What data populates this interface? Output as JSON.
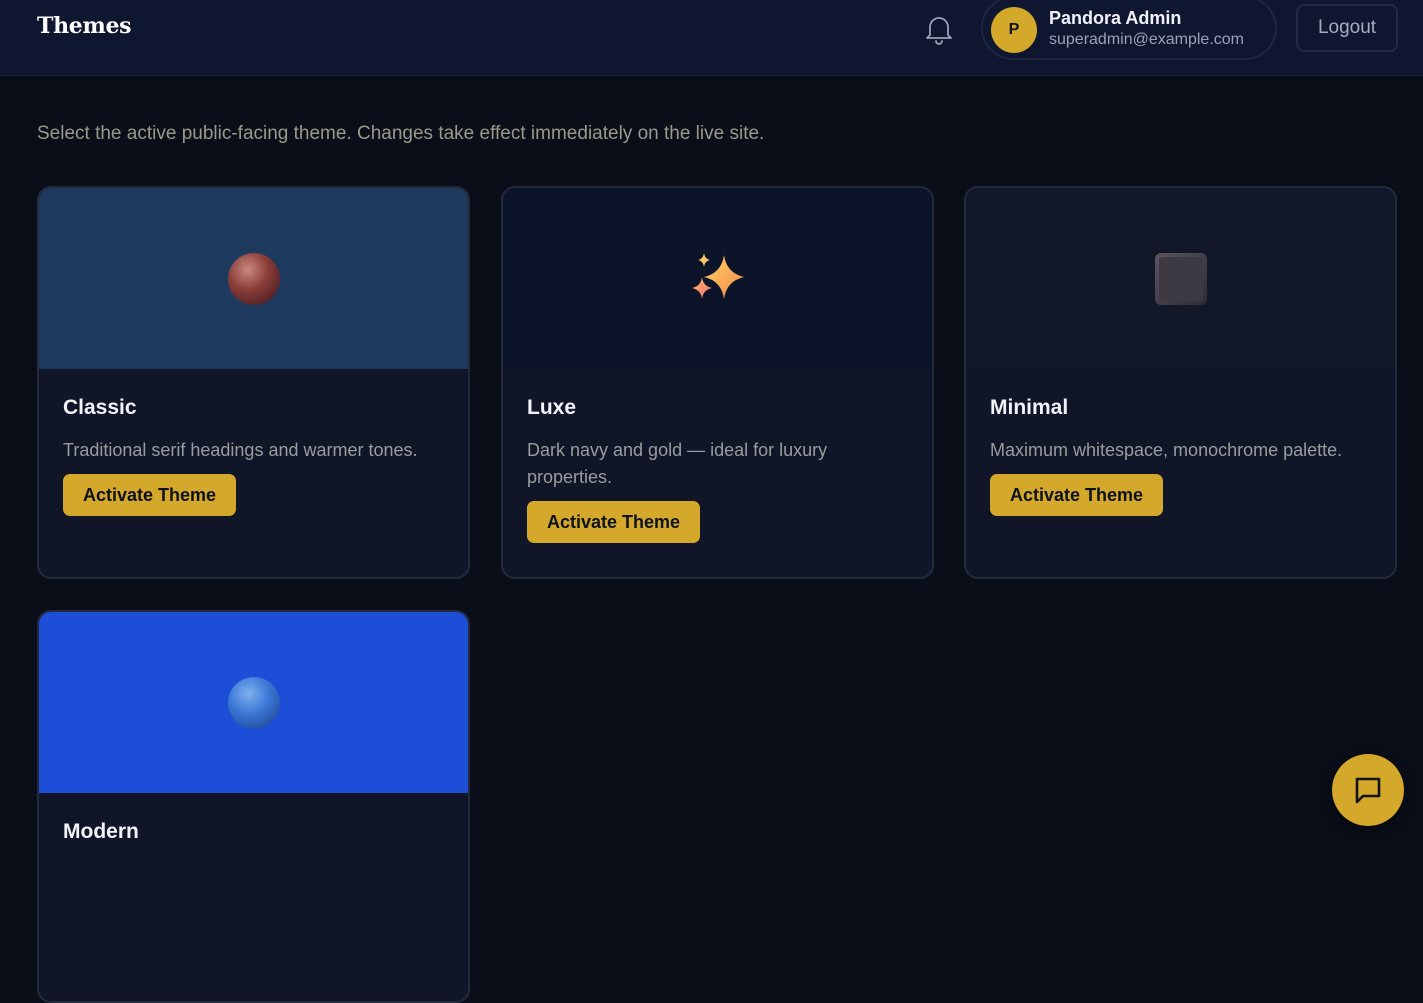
{
  "header": {
    "title": "Themes",
    "user": {
      "initial": "P",
      "name": "Pandora Admin",
      "email": "superadmin@example.com"
    },
    "logout_label": "Logout"
  },
  "main": {
    "intro": "Select the active public-facing theme. Changes take effect immediately on the live site.",
    "themes": [
      {
        "name": "Classic",
        "description": "Traditional serif headings and warmer tones.",
        "button": "Activate Theme",
        "icon": "red-sphere-icon",
        "preview_color": "#1f3a5f"
      },
      {
        "name": "Luxe",
        "description": "Dark navy and gold — ideal for luxury properties.",
        "button": "Activate Theme",
        "icon": "sparkles-icon",
        "preview_color": "#0b1428"
      },
      {
        "name": "Minimal",
        "description": "Maximum whitespace, monochrome palette.",
        "button": "Activate Theme",
        "icon": "dark-square-icon",
        "preview_color": "#121828"
      },
      {
        "name": "Modern",
        "icon": "blue-sphere-icon",
        "preview_color": "#1d4ed8"
      }
    ]
  },
  "colors": {
    "accent": "#d4a82a",
    "background": "#0a0e19",
    "card": "#101528"
  }
}
